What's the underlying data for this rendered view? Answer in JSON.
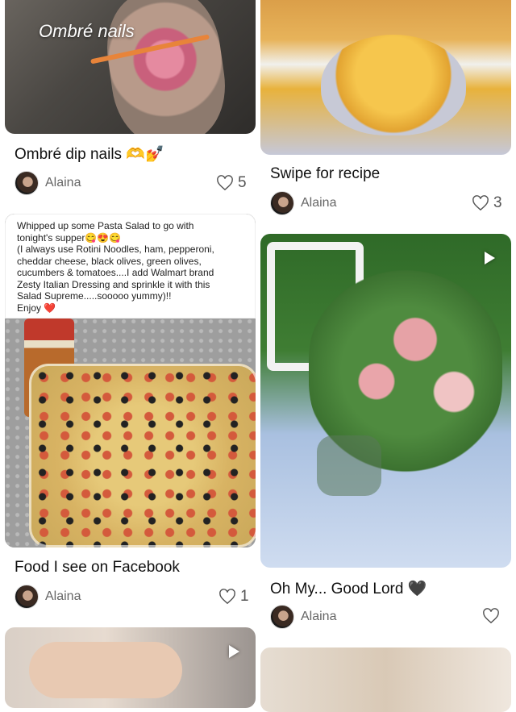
{
  "cards": [
    {
      "title": "Ombré dip nails 🫶💅",
      "overlay": "Ombré nails",
      "author": "Alaina",
      "likes": "5"
    },
    {
      "title": "Swipe for recipe",
      "author": "Alaina",
      "likes": "3"
    },
    {
      "title": "Food I see on Facebook",
      "author": "Alaina",
      "likes": "1",
      "caption_lines": [
        "Whipped up some Pasta Salad to go with",
        "tonight's supper😋😍😋",
        "(I always use Rotini Noodles, ham, pepperoni,",
        "cheddar cheese, black olives, green olives,",
        "cucumbers & tomatoes....I add Walmart brand",
        "Zesty Italian Dressing and sprinkle it with this",
        "Salad Supreme.....sooooo yummy)!!",
        "Enjoy ❤️"
      ]
    },
    {
      "title": "Oh My... Good Lord 🖤",
      "author": "Alaina",
      "likes": ""
    }
  ],
  "icons": {
    "heart": "heart-icon",
    "play": "play-icon"
  }
}
